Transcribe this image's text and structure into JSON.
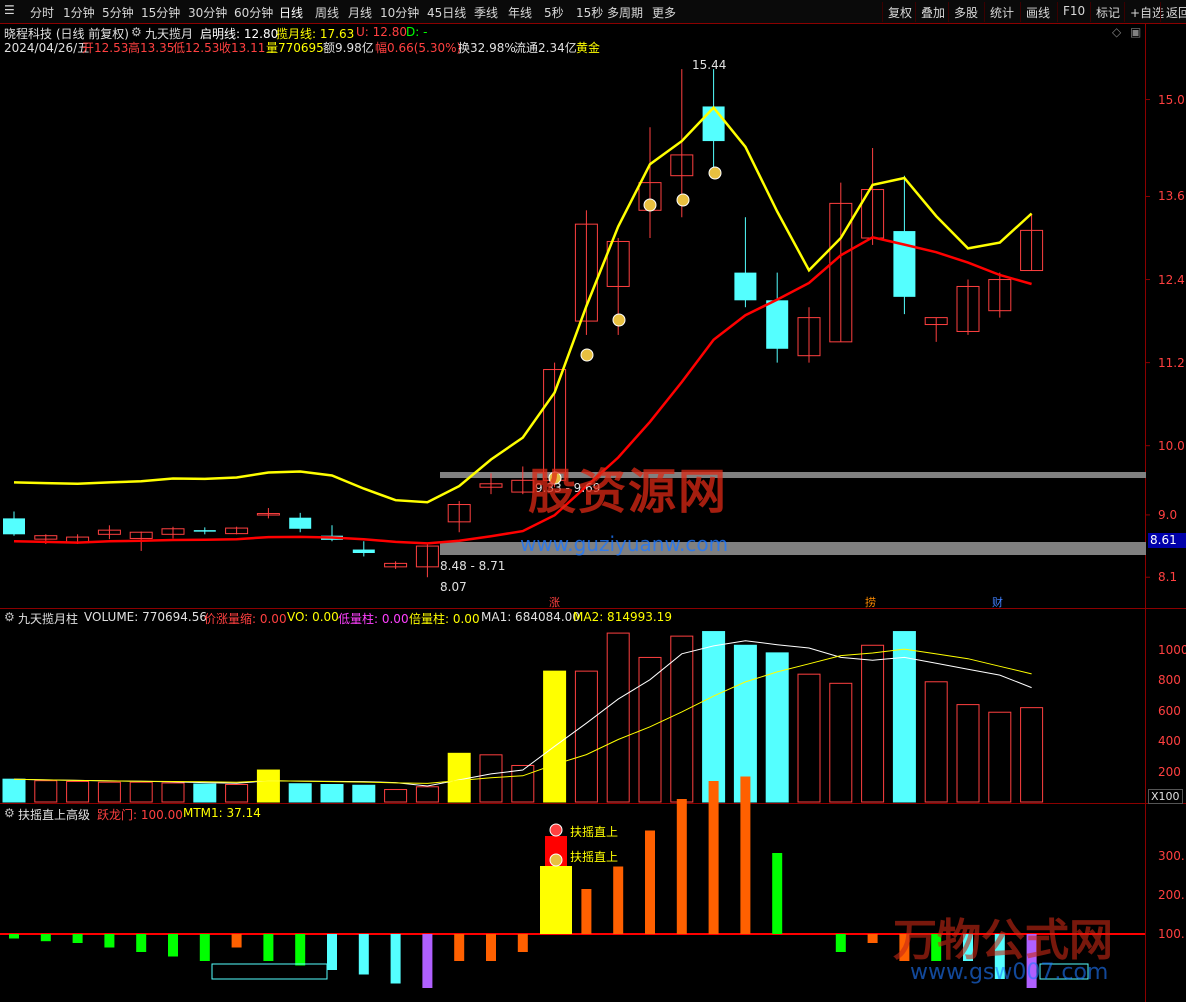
{
  "toolbar": {
    "periods": [
      "分时",
      "1分钟",
      "5分钟",
      "15分钟",
      "30分钟",
      "60分钟",
      "日线",
      "周线",
      "月线",
      "10分钟",
      "45日线",
      "季线",
      "年线",
      "5秒",
      "15秒",
      "多周期",
      "更多"
    ],
    "active_period": "日线",
    "right_buttons": [
      "复权",
      "叠加",
      "多股",
      "统计",
      "画线",
      "F10",
      "标记",
      "+自选",
      "返回"
    ]
  },
  "stock": {
    "name_line": "晓程科技 (日线 前复权)",
    "indicator_name": "九天揽月",
    "qiming_label": "启明线: 12.80",
    "lanyue_label": "揽月线: 17.63",
    "u_label": "U: 12.80",
    "d_label": "D: -",
    "date": "2024/04/26/五",
    "open": "开12.53",
    "high": "高13.35",
    "low": "低12.53",
    "close": "收13.11",
    "volume": "量770695",
    "amount": "额9.98亿",
    "change": "幅0.66(5.30%)",
    "turnover": "换32.98%",
    "float_shares": "流通2.34亿",
    "tag": "黄金"
  },
  "price_annotations": {
    "high_label": "15.44",
    "range_label_1": "9.33 - 9.69",
    "range_label_2": "8.48 - 8.71",
    "low_label": "8.07",
    "current_price_tag": "8.61",
    "marker_zhang": "涨",
    "marker_lao": "捞",
    "marker_cai": "财"
  },
  "colors": {
    "up": "#ff4040",
    "down": "#54ffff",
    "ma_yellow": "#ffff00",
    "ma_red": "#ff0000",
    "axis": "#8b0000",
    "band_gray": "#808080"
  },
  "price_axis": {
    "ticks": [
      "15.0",
      "13.6",
      "12.4",
      "11.2",
      "10.0",
      "9.0",
      "8.1"
    ],
    "ylim": [
      7.8,
      15.6
    ]
  },
  "volume_panel": {
    "title": "九天揽月柱",
    "volume": "VOLUME: 770694.56",
    "jzll": "价涨量缩: 0.00",
    "vo": "VO: 0.00",
    "dlz": "低量柱: 0.00",
    "blz": "倍量柱: 0.00",
    "ma1": "MA1: 684084.00",
    "ma2": "MA2: 814993.19",
    "ticks": [
      "1000",
      "800",
      "600",
      "400",
      "200"
    ],
    "unit": "X100"
  },
  "bottom_panel": {
    "title": "扶摇直上高级",
    "ylm": "跃龙门: 100.00",
    "mtm": "MTM1: 37.14",
    "ticks": [
      "300.",
      "200.",
      "100."
    ],
    "label_1": "扶摇直上",
    "label_2": "扶摇直上"
  },
  "watermarks": {
    "main_text": "股资源网",
    "main_url": "www.guziyuanw.com",
    "bottom_text": "万物公式网",
    "bottom_url": "www.gsw007.com"
  },
  "chart_data": {
    "type": "candlestick",
    "ohlc": [
      [
        8.95,
        9.05,
        8.7,
        8.72
      ],
      [
        8.65,
        8.72,
        8.58,
        8.7
      ],
      [
        8.6,
        8.72,
        8.58,
        8.68
      ],
      [
        8.72,
        8.85,
        8.65,
        8.78
      ],
      [
        8.66,
        8.76,
        8.48,
        8.75
      ],
      [
        8.72,
        8.83,
        8.66,
        8.8
      ],
      [
        8.78,
        8.82,
        8.72,
        8.76
      ],
      [
        8.73,
        8.83,
        8.72,
        8.81
      ],
      [
        9.0,
        9.1,
        8.95,
        9.02
      ],
      [
        8.96,
        9.03,
        8.75,
        8.8
      ],
      [
        8.7,
        8.85,
        8.62,
        8.64
      ],
      [
        8.5,
        8.62,
        8.4,
        8.45
      ],
      [
        8.25,
        8.33,
        8.22,
        8.3
      ],
      [
        8.25,
        8.6,
        8.1,
        8.55
      ],
      [
        8.9,
        9.2,
        8.75,
        9.15
      ],
      [
        9.4,
        9.6,
        9.3,
        9.45
      ],
      [
        9.33,
        9.7,
        9.3,
        9.5
      ],
      [
        9.5,
        11.2,
        9.4,
        11.1
      ],
      [
        11.8,
        13.4,
        11.6,
        13.2
      ],
      [
        12.3,
        13.0,
        11.6,
        12.95
      ],
      [
        13.4,
        14.6,
        13.0,
        13.8
      ],
      [
        13.9,
        15.44,
        13.3,
        14.2
      ],
      [
        14.9,
        15.44,
        14.0,
        14.4
      ],
      [
        12.5,
        13.3,
        12.0,
        12.1
      ],
      [
        12.1,
        12.5,
        11.2,
        11.4
      ],
      [
        11.3,
        12.0,
        11.2,
        11.85
      ],
      [
        11.5,
        13.8,
        11.5,
        13.5
      ],
      [
        13.0,
        14.3,
        12.9,
        13.7
      ],
      [
        13.1,
        13.9,
        11.9,
        12.15
      ],
      [
        11.75,
        11.85,
        11.5,
        11.85
      ],
      [
        11.65,
        12.4,
        11.6,
        12.3
      ],
      [
        11.95,
        12.5,
        11.85,
        12.4
      ],
      [
        12.53,
        13.35,
        12.53,
        13.11
      ]
    ],
    "volume": [
      150,
      140,
      135,
      130,
      130,
      125,
      118,
      115,
      210,
      120,
      115,
      110,
      82,
      100,
      320,
      310,
      240,
      860,
      860,
      1110,
      950,
      1090,
      1120,
      1030,
      980,
      840,
      780,
      1030,
      1120,
      790,
      640,
      590,
      620,
      770
    ]
  }
}
